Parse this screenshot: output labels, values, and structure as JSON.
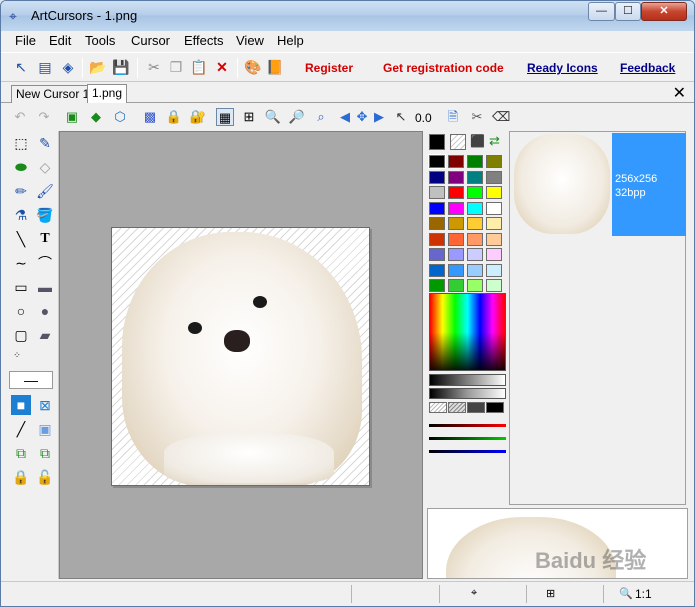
{
  "window": {
    "title": "ArtCursors - 1.png",
    "minimize": "—",
    "maximize": "☐",
    "close": "✕"
  },
  "menu": [
    "File",
    "Edit",
    "Tools",
    "Cursor",
    "Effects",
    "View",
    "Help"
  ],
  "toolbar": {
    "links_red": [
      "Register",
      "Get registration code"
    ],
    "links_blue": [
      "Ready Icons",
      "Feedback"
    ]
  },
  "tabs": [
    {
      "label": "New Cursor 1"
    },
    {
      "label": "1.png"
    }
  ],
  "tabs_close": "✕",
  "toolbar2": {
    "coord": "0.0"
  },
  "preview": {
    "size": "256x256",
    "bpp": "32bpp"
  },
  "status": {
    "zoom": "1:1"
  },
  "watermark": "Baidu 经验",
  "colors": {
    "palette": [
      "#000000",
      "#800000",
      "#008000",
      "#808000",
      "#000080",
      "#800080",
      "#008080",
      "#808080",
      "#c0c0c0",
      "#ff0000",
      "#00ff00",
      "#ffff00",
      "#0000ff",
      "#ff00ff",
      "#00ffff",
      "#ffffff",
      "#996600",
      "#cc9900",
      "#ffcc33",
      "#ffeeaa",
      "#cc3300",
      "#ff6633",
      "#ff9966",
      "#ffcc99",
      "#6666cc",
      "#9999ff",
      "#ccccff",
      "#ffccff",
      "#0066cc",
      "#3399ff",
      "#99ccff",
      "#cceeff",
      "#009900",
      "#33cc33",
      "#99ff66",
      "#ccffcc"
    ],
    "primary": "#000000",
    "secondary": "#ffffff",
    "accent": "#3399ff"
  }
}
